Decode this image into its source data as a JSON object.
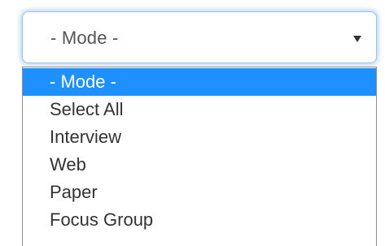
{
  "select": {
    "value": "- Mode -"
  },
  "dropdown": {
    "options": [
      {
        "label": "- Mode -",
        "selected": true
      },
      {
        "label": "Select All",
        "selected": false
      },
      {
        "label": "Interview",
        "selected": false
      },
      {
        "label": "Web",
        "selected": false
      },
      {
        "label": "Paper",
        "selected": false
      },
      {
        "label": "Focus Group",
        "selected": false
      }
    ]
  },
  "colors": {
    "highlight": "#1e90ff",
    "focus_ring": "#66a0e1",
    "text": "#333333"
  },
  "icons": {
    "arrow": "chevron-down-icon"
  }
}
